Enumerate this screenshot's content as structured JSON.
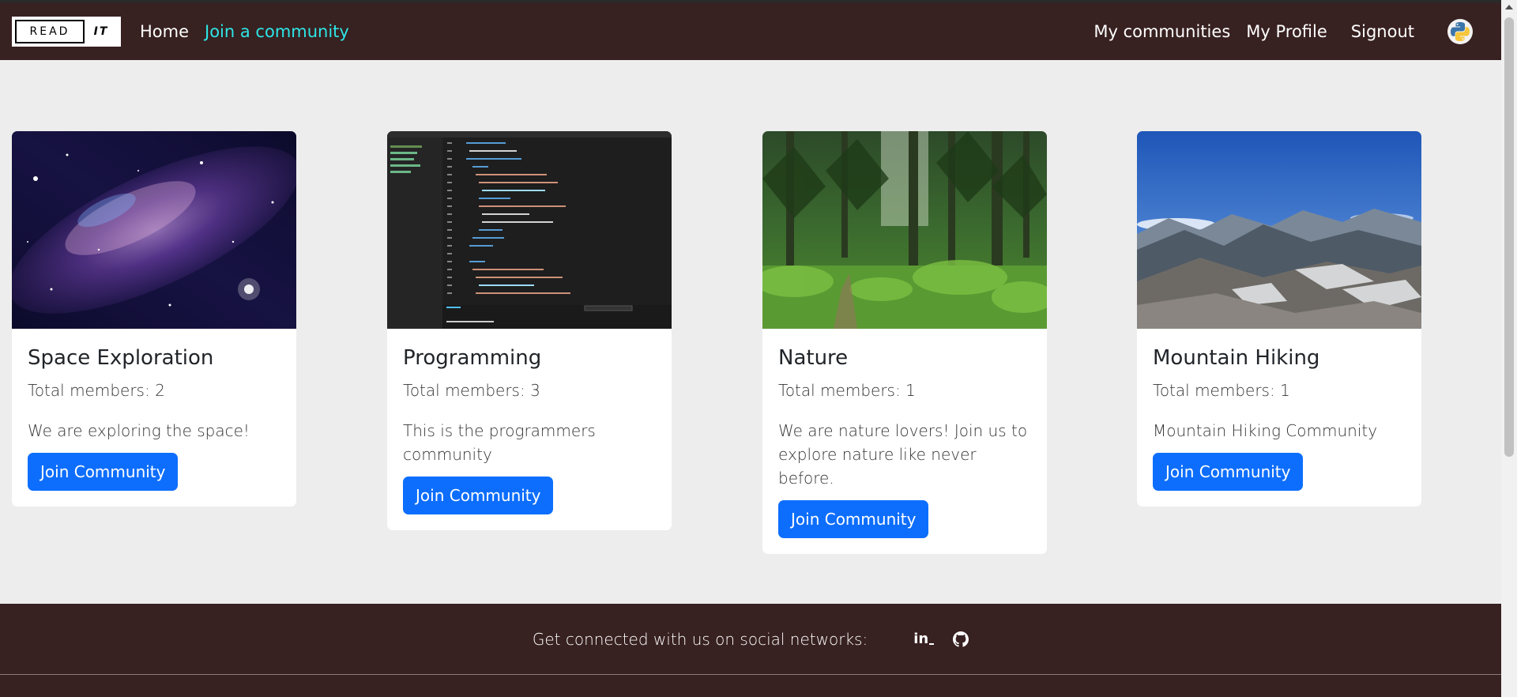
{
  "navbar": {
    "brand_left": "READ",
    "brand_right": "IT",
    "links": [
      {
        "label": "Home"
      },
      {
        "label": "Join a community"
      }
    ],
    "right_links": [
      {
        "label": "My communities"
      },
      {
        "label": "My Profile"
      },
      {
        "label": "Signout"
      }
    ],
    "avatar_icon": "python-logo-icon"
  },
  "colors": {
    "navbar_bg": "#382121",
    "active_link": "#2ee6e6",
    "button": "#0d6efd",
    "page_bg": "#ededed"
  },
  "communities": [
    {
      "title": "Space Exploration",
      "members": "Total members: 2",
      "description": "We are exploring the space!",
      "button": "Join Community",
      "image": "galaxy-image"
    },
    {
      "title": "Programming",
      "members": "Total members: 3",
      "description": "This is the programmers community",
      "button": "Join Community",
      "image": "code-editor-image"
    },
    {
      "title": "Nature",
      "members": "Total members: 1",
      "description": "We are nature lovers! Join us to explore nature like never before.",
      "button": "Join Community",
      "image": "forest-image"
    },
    {
      "title": "Mountain Hiking",
      "members": "Total members: 1",
      "description": "Mountain Hiking Community",
      "button": "Join Community",
      "image": "mountain-image"
    }
  ],
  "footer": {
    "text": "Get connected with us on social networks:",
    "linkedin_label": "in",
    "icons": [
      "linkedin-icon",
      "github-icon"
    ]
  }
}
